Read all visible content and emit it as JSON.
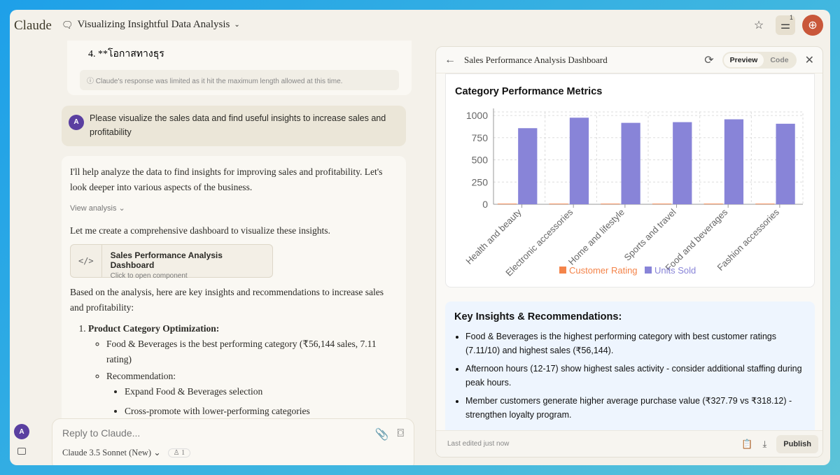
{
  "app": {
    "logo": "Claude",
    "conversation_title": "Visualizing Insightful Data Analysis",
    "notif_count": "1"
  },
  "chat": {
    "previous_tail": "4. **โอกาสทางธุร",
    "limit_notice": "Claude's response was limited as it hit the maximum length allowed at this time.",
    "user_avatar": "A",
    "user_message": "Please visualize the sales data and find useful insights to increase sales and profitability",
    "resp_intro": "I'll help analyze the data to find insights for improving sales and profitability. Let's look deeper into various aspects of the business.",
    "view_analysis": "View analysis",
    "resp_dashboard": "Let me create a comprehensive dashboard to visualize these insights.",
    "component": {
      "title": "Sales Performance Analysis Dashboard",
      "subtitle": "Click to open component",
      "icon": "code-icon"
    },
    "resp_based": "Based on the analysis, here are key insights and recommendations to increase sales and profitability:",
    "section1": "Product Category Optimization:",
    "s1_b1": "Food & Beverages is the best performing category (₹56,144 sales, 7.11 rating)",
    "s1_b2": "Recommendation:",
    "s1_sub": [
      "Expand Food & Beverages selection",
      "Cross-promote with lower-performing categories"
    ]
  },
  "input": {
    "placeholder": "Reply to Claude...",
    "model": "Claude 3.5 Sonnet (New)",
    "badge": "1"
  },
  "artifact": {
    "title": "Sales Performance Analysis Dashboard",
    "tabs": [
      "Preview",
      "Code"
    ],
    "chart_title": "Category Performance Metrics",
    "insights_title": "Key Insights & Recommendations:",
    "insights": [
      "Food & Beverages is the highest performing category with best customer ratings (7.11/10) and highest sales (₹56,144).",
      "Afternoon hours (12-17) show highest sales activity - consider additional staffing during peak hours.",
      "Member customers generate higher average purchase value (₹327.79 vs ₹318.12) - strengthen loyalty program."
    ],
    "last_edited": "Last edited just now",
    "publish": "Publish"
  },
  "chart_data": {
    "type": "bar",
    "title": "Category Performance Metrics",
    "categories": [
      "Health and beauty",
      "Electronic accessories",
      "Home and lifestyle",
      "Sports and travel",
      "Food and beverages",
      "Fashion accessories"
    ],
    "series": [
      {
        "name": "Customer Rating",
        "color": "#f4844a",
        "values": [
          7.0,
          6.9,
          6.8,
          6.9,
          7.11,
          7.0
        ]
      },
      {
        "name": "Units Sold",
        "color": "#8884d8",
        "values": [
          857,
          975,
          917,
          925,
          957,
          907
        ]
      }
    ],
    "yticks": [
      0,
      250,
      500,
      750,
      1000
    ],
    "ylim": [
      0,
      1000
    ],
    "grid": true,
    "legend": "bottom"
  }
}
